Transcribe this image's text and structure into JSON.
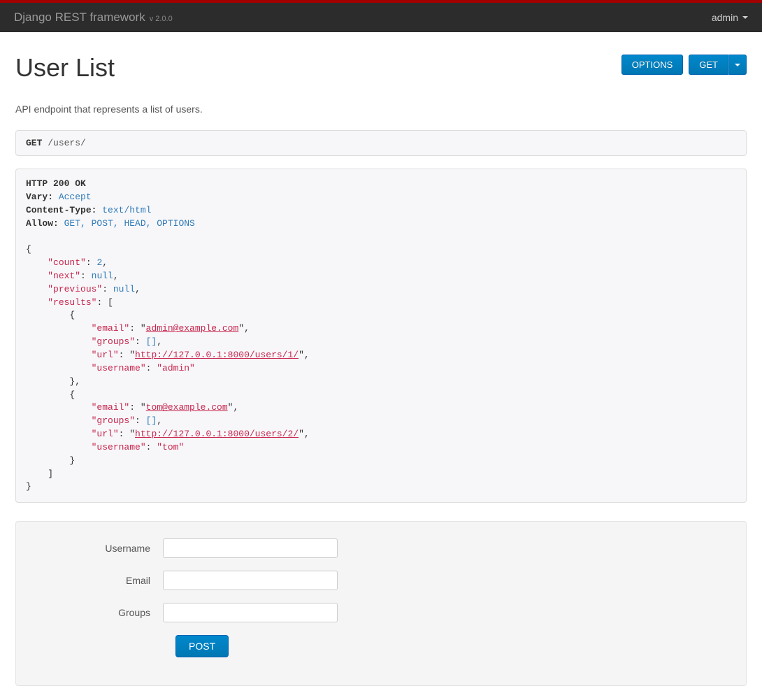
{
  "navbar": {
    "brand": "Django REST framework",
    "version": "v 2.0.0",
    "user": "admin"
  },
  "header": {
    "title": "User List",
    "options_label": "OPTIONS",
    "get_label": "GET"
  },
  "description": "API endpoint that represents a list of users.",
  "request": {
    "method": "GET",
    "path": "/users/"
  },
  "response": {
    "status_line": "HTTP 200 OK",
    "headers": {
      "Vary": "Accept",
      "Content-Type": "text/html",
      "Allow": "GET, POST, HEAD, OPTIONS"
    },
    "body": {
      "count": 2,
      "next": null,
      "previous": null,
      "results": [
        {
          "email": "admin@example.com",
          "groups": [],
          "url": "http://127.0.0.1:8000/users/1/",
          "username": "admin"
        },
        {
          "email": "tom@example.com",
          "groups": [],
          "url": "http://127.0.0.1:8000/users/2/",
          "username": "tom"
        }
      ]
    }
  },
  "form": {
    "username_label": "Username",
    "email_label": "Email",
    "groups_label": "Groups",
    "username_value": "",
    "email_value": "",
    "groups_value": "",
    "submit_label": "POST"
  }
}
